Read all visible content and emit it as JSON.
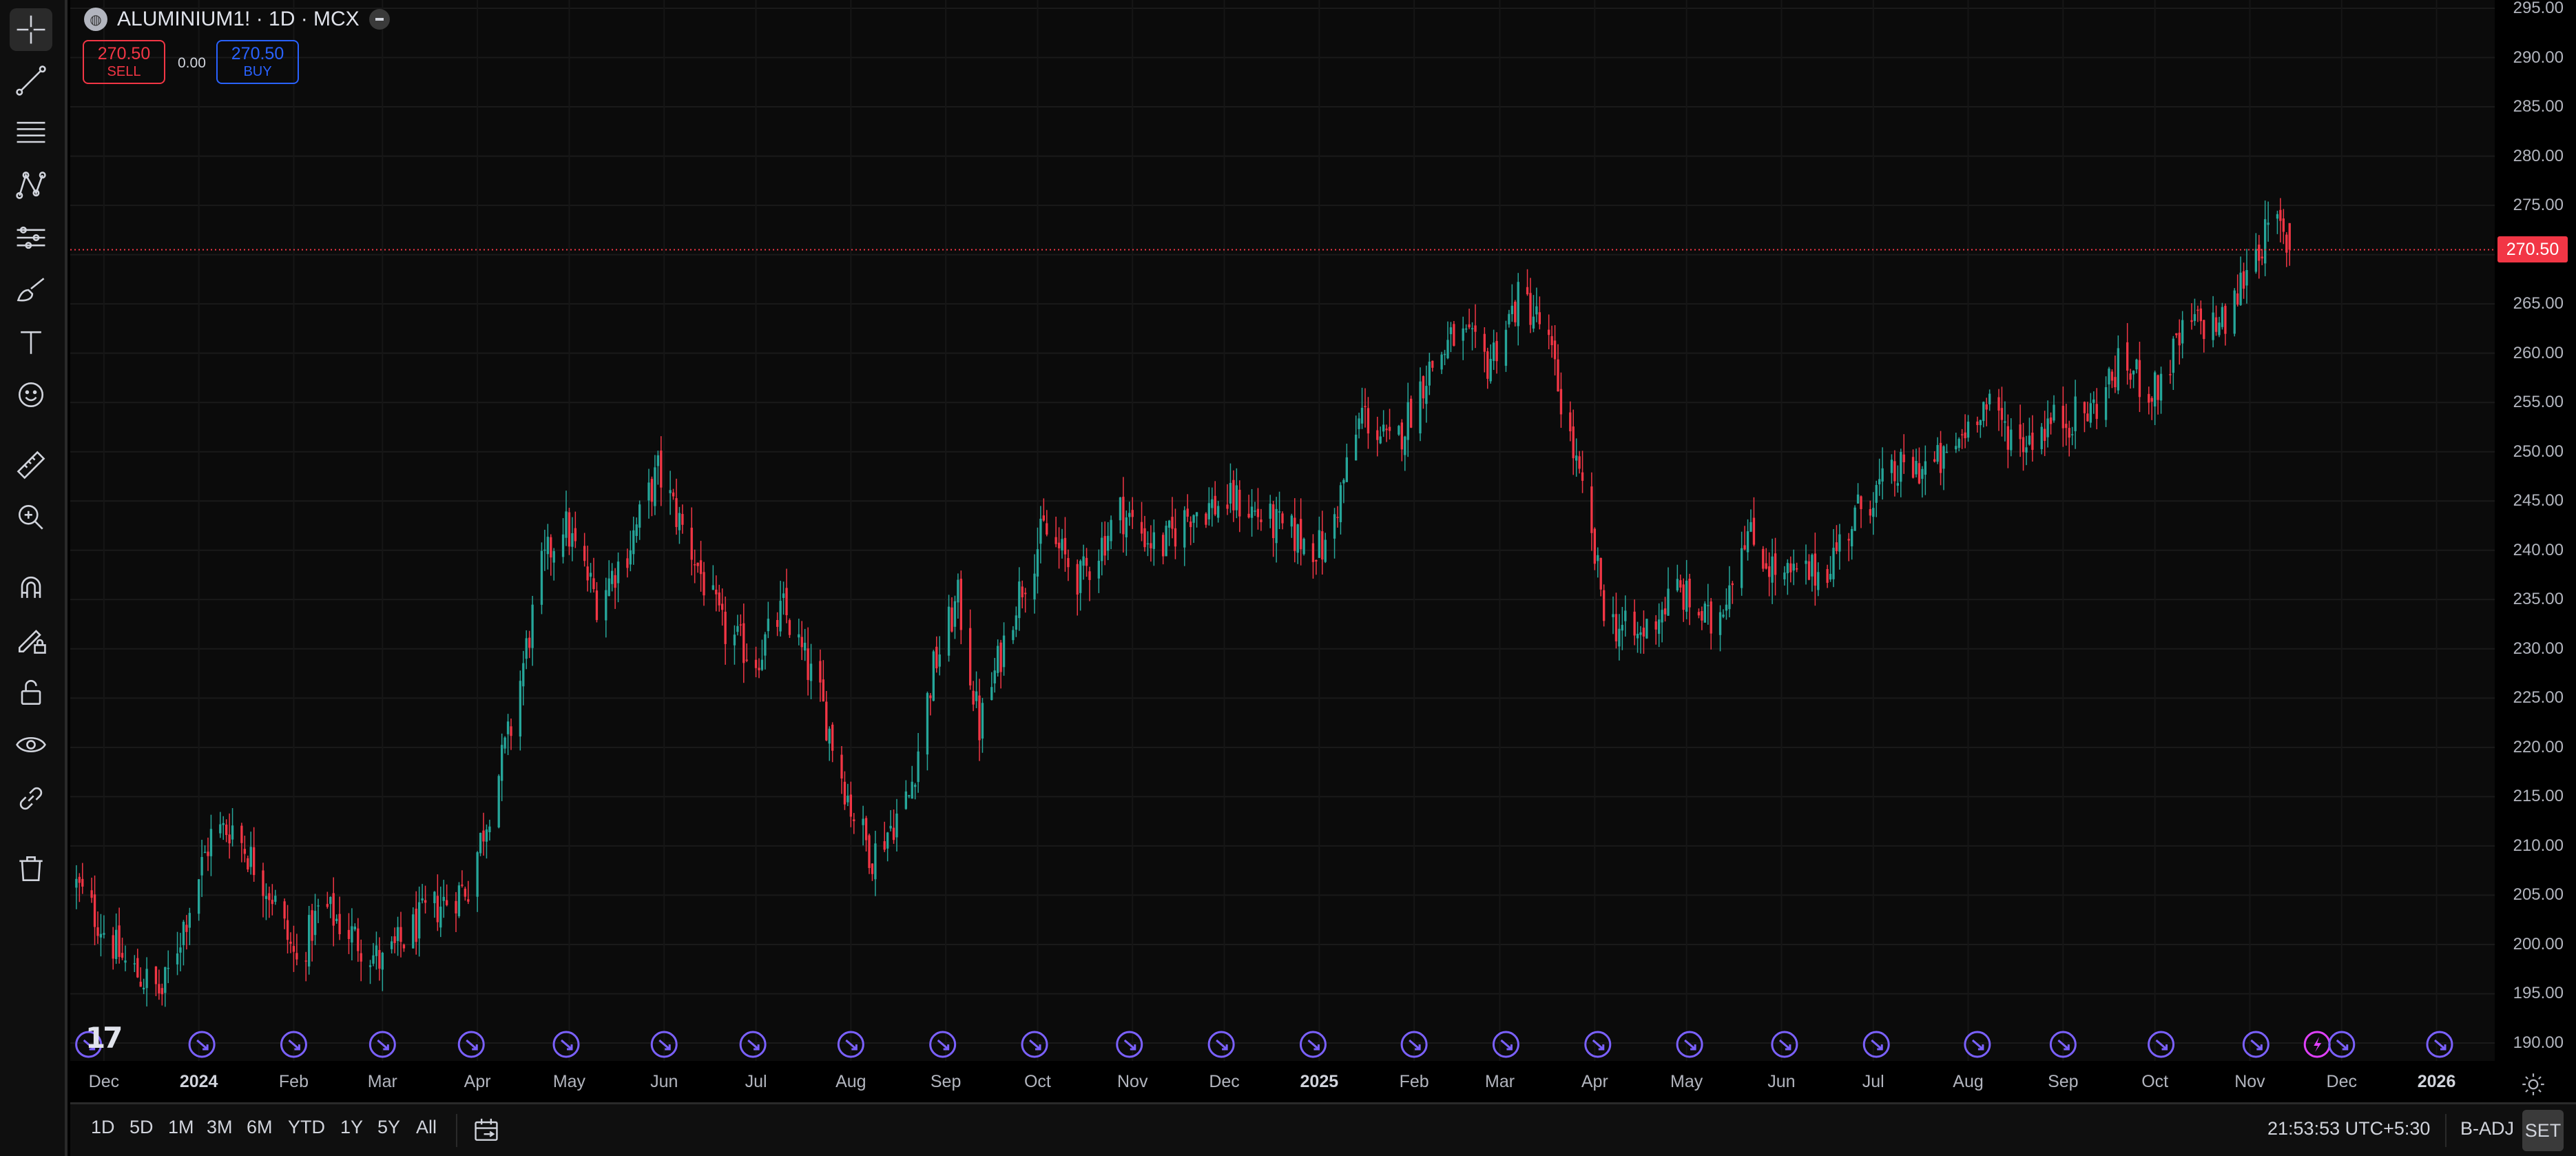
{
  "legend": {
    "symbol": "ALUMINIUM1! · 1D · MCX",
    "sell_price": "270.50",
    "sell_label": "SELL",
    "buy_price": "270.50",
    "buy_label": "BUY",
    "spread": "0.00"
  },
  "toolbar": {
    "tools": [
      "crosshair-icon",
      "trend-line-icon",
      "fib-retracement-icon",
      "pattern-icon",
      "forecast-icon",
      "brush-icon",
      "text-icon",
      "emoji-icon",
      "ruler-icon",
      "zoom-in-icon",
      "magnet-icon",
      "lock-drawing-icon",
      "lock-icon",
      "eye-icon",
      "link-icon",
      "trash-icon"
    ]
  },
  "price_scale": {
    "ticks": [
      "295.00",
      "290.00",
      "285.00",
      "280.00",
      "275.00",
      "270.00",
      "265.00",
      "260.00",
      "255.00",
      "250.00",
      "245.00",
      "240.00",
      "235.00",
      "230.00",
      "225.00",
      "220.00",
      "215.00",
      "210.00",
      "205.00",
      "200.00",
      "195.00",
      "190.00"
    ],
    "last_price": "270.50"
  },
  "time_axis": {
    "ticks": [
      {
        "label": "Dec",
        "bold": false
      },
      {
        "label": "2024",
        "bold": true
      },
      {
        "label": "Feb",
        "bold": false
      },
      {
        "label": "Mar",
        "bold": false
      },
      {
        "label": "Apr",
        "bold": false
      },
      {
        "label": "May",
        "bold": false
      },
      {
        "label": "Jun",
        "bold": false
      },
      {
        "label": "Jul",
        "bold": false
      },
      {
        "label": "Aug",
        "bold": false
      },
      {
        "label": "Sep",
        "bold": false
      },
      {
        "label": "Oct",
        "bold": false
      },
      {
        "label": "Nov",
        "bold": false
      },
      {
        "label": "Dec",
        "bold": false
      },
      {
        "label": "2025",
        "bold": true
      },
      {
        "label": "Feb",
        "bold": false
      },
      {
        "label": "Mar",
        "bold": false
      },
      {
        "label": "Apr",
        "bold": false
      },
      {
        "label": "May",
        "bold": false
      },
      {
        "label": "Jun",
        "bold": false
      },
      {
        "label": "Jul",
        "bold": false
      },
      {
        "label": "Aug",
        "bold": false
      },
      {
        "label": "Sep",
        "bold": false
      },
      {
        "label": "Oct",
        "bold": false
      },
      {
        "label": "Nov",
        "bold": false
      },
      {
        "label": "Dec",
        "bold": false
      },
      {
        "label": "2026",
        "bold": true
      }
    ]
  },
  "bottom_bar": {
    "ranges": [
      "1D",
      "5D",
      "1M",
      "3M",
      "6M",
      "YTD",
      "1Y",
      "5Y",
      "All"
    ],
    "clock": "21:53:53 UTC+5:30",
    "adjustment": "B-ADJ",
    "session": "SET"
  },
  "colors": {
    "up": "#26a69a",
    "down": "#f23645",
    "event_marker": "#7b61ff",
    "background": "#0b0b0b"
  },
  "chart_data": {
    "type": "candlestick",
    "symbol": "ALUMINIUM1!",
    "interval": "1D",
    "exchange": "MCX",
    "ylim": [
      190,
      295
    ],
    "last_price": 270.5,
    "x_range": [
      "2023-11-20",
      "2026-01-20"
    ],
    "anchor_closes": [
      [
        "2023-11-22",
        206
      ],
      [
        "2023-12-08",
        198
      ],
      [
        "2023-12-20",
        195
      ],
      [
        "2024-01-05",
        211
      ],
      [
        "2024-01-12",
        212
      ],
      [
        "2024-01-25",
        205
      ],
      [
        "2024-02-02",
        198
      ],
      [
        "2024-02-10",
        204
      ],
      [
        "2024-02-20",
        201
      ],
      [
        "2024-03-01",
        198
      ],
      [
        "2024-03-15",
        203
      ],
      [
        "2024-03-29",
        206
      ],
      [
        "2024-04-12",
        222
      ],
      [
        "2024-04-22",
        238
      ],
      [
        "2024-04-29",
        243
      ],
      [
        "2024-05-10",
        235
      ],
      [
        "2024-05-20",
        240
      ],
      [
        "2024-05-30",
        248
      ],
      [
        "2024-06-10",
        240
      ],
      [
        "2024-06-20",
        232
      ],
      [
        "2024-07-01",
        229
      ],
      [
        "2024-07-10",
        234
      ],
      [
        "2024-07-22",
        225
      ],
      [
        "2024-08-01",
        214
      ],
      [
        "2024-08-08",
        209
      ],
      [
        "2024-08-20",
        215
      ],
      [
        "2024-08-28",
        228
      ],
      [
        "2024-09-05",
        235
      ],
      [
        "2024-09-12",
        222
      ],
      [
        "2024-09-24",
        235
      ],
      [
        "2024-10-03",
        242
      ],
      [
        "2024-10-15",
        237
      ],
      [
        "2024-10-28",
        244
      ],
      [
        "2024-11-10",
        240
      ],
      [
        "2024-11-20",
        244
      ],
      [
        "2024-12-05",
        245
      ],
      [
        "2024-12-20",
        242
      ],
      [
        "2025-01-03",
        240
      ],
      [
        "2025-01-15",
        254
      ],
      [
        "2025-01-25",
        250
      ],
      [
        "2025-02-05",
        258
      ],
      [
        "2025-02-15",
        262
      ],
      [
        "2025-02-25",
        259
      ],
      [
        "2025-03-08",
        266
      ],
      [
        "2025-03-16",
        262
      ],
      [
        "2025-03-25",
        250
      ],
      [
        "2025-04-05",
        233
      ],
      [
        "2025-04-15",
        231
      ],
      [
        "2025-04-28",
        236
      ],
      [
        "2025-05-10",
        232
      ],
      [
        "2025-05-20",
        242
      ],
      [
        "2025-06-01",
        237
      ],
      [
        "2025-06-15",
        238
      ],
      [
        "2025-06-28",
        245
      ],
      [
        "2025-07-10",
        248
      ],
      [
        "2025-07-25",
        249
      ],
      [
        "2025-08-05",
        255
      ],
      [
        "2025-08-18",
        251
      ],
      [
        "2025-08-28",
        253
      ],
      [
        "2025-09-10",
        254
      ],
      [
        "2025-09-20",
        259
      ],
      [
        "2025-10-01",
        256
      ],
      [
        "2025-10-12",
        263
      ],
      [
        "2025-10-25",
        263
      ],
      [
        "2025-11-01",
        270
      ],
      [
        "2025-11-10",
        273
      ],
      [
        "2025-11-14",
        270.5
      ]
    ],
    "events": [
      {
        "date": "2023-11-26",
        "kind": "dividend"
      },
      {
        "date": "2024-01-02",
        "kind": "dividend"
      },
      {
        "date": "2024-02-01",
        "kind": "dividend"
      },
      {
        "date": "2024-03-01",
        "kind": "dividend"
      },
      {
        "date": "2024-03-30",
        "kind": "dividend"
      },
      {
        "date": "2024-04-30",
        "kind": "dividend"
      },
      {
        "date": "2024-06-01",
        "kind": "dividend"
      },
      {
        "date": "2024-06-30",
        "kind": "dividend"
      },
      {
        "date": "2024-08-01",
        "kind": "dividend"
      },
      {
        "date": "2024-08-31",
        "kind": "dividend"
      },
      {
        "date": "2024-09-30",
        "kind": "dividend"
      },
      {
        "date": "2024-10-31",
        "kind": "dividend"
      },
      {
        "date": "2024-11-30",
        "kind": "dividend"
      },
      {
        "date": "2024-12-30",
        "kind": "dividend"
      },
      {
        "date": "2025-02-01",
        "kind": "dividend"
      },
      {
        "date": "2025-03-03",
        "kind": "dividend"
      },
      {
        "date": "2025-04-02",
        "kind": "dividend"
      },
      {
        "date": "2025-05-02",
        "kind": "dividend"
      },
      {
        "date": "2025-06-02",
        "kind": "dividend"
      },
      {
        "date": "2025-07-02",
        "kind": "dividend"
      },
      {
        "date": "2025-08-04",
        "kind": "dividend"
      },
      {
        "date": "2025-09-01",
        "kind": "dividend"
      },
      {
        "date": "2025-10-03",
        "kind": "dividend"
      },
      {
        "date": "2025-11-03",
        "kind": "dividend"
      },
      {
        "date": "2025-11-23",
        "kind": "earnings"
      },
      {
        "date": "2025-12-01",
        "kind": "dividend"
      },
      {
        "date": "2026-01-02",
        "kind": "dividend"
      }
    ]
  }
}
